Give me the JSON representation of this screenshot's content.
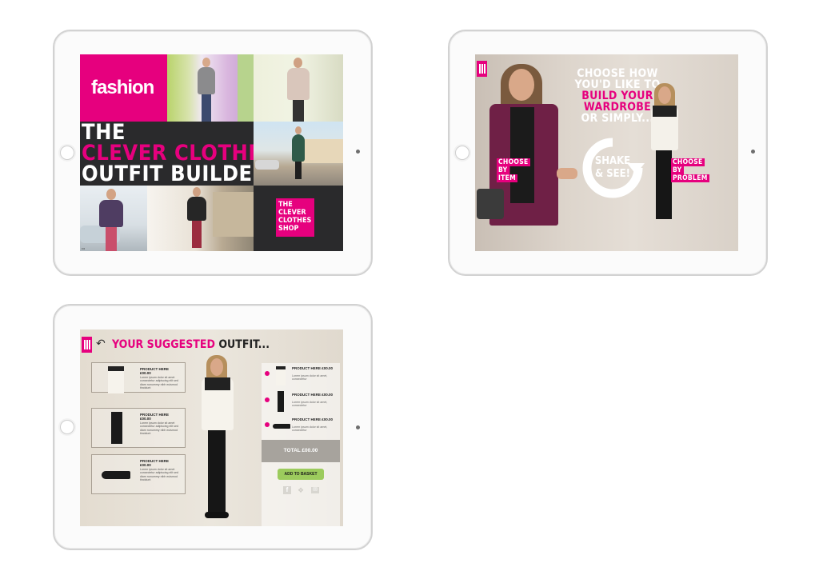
{
  "screen1": {
    "logo": "fashion",
    "title_line1": "THE",
    "title_line2": "CLEVER CLOTHES",
    "title_line3": "OUTFIT BUILDER",
    "shop_badge": "THE CLEVER CLOTHES SHOP"
  },
  "screen2": {
    "headline_line1": "CHOOSE HOW",
    "headline_line2": "YOU'D LIKE TO",
    "headline_line3": "BUILD YOUR",
    "headline_line4": "WARDROBE",
    "headline_line5": "OR SIMPLY...",
    "shake_line1": "SHAKE",
    "shake_line2": "& SEE!",
    "choose_item": [
      "CHOOSE",
      "BY",
      "ITEM"
    ],
    "choose_problem": [
      "CHOOSE",
      "BY",
      "PROBLEM"
    ]
  },
  "screen3": {
    "title_highlight": "YOUR SUGGESTED",
    "title_rest": "OUTFIT...",
    "products": [
      {
        "name": "PRODUCT HERE",
        "price": "£00.00",
        "desc": "Lorem ipsum dolor sit amet consectetur adipiscing elit sed diam nonummy nibh euismod tincidunt"
      },
      {
        "name": "PRODUCT HERE",
        "price": "£00.00",
        "desc": "Lorem ipsum dolor sit amet consectetur adipiscing elit sed diam nonummy nibh euismod tincidunt"
      },
      {
        "name": "PRODUCT HERE",
        "price": "£00.00",
        "desc": "Lorem ipsum dolor sit amet consectetur adipiscing elit sed diam nonummy nibh euismod tincidunt"
      }
    ],
    "summary": [
      {
        "name": "PRODUCT HERE £00.00",
        "desc": "Lorem ipsum dolor sit amet, consectetur"
      },
      {
        "name": "PRODUCT HERE £00.00",
        "desc": "Lorem ipsum dolor sit amet, consectetur"
      },
      {
        "name": "PRODUCT HERE £00.00",
        "desc": "Lorem ipsum dolor sit amet, consectetur"
      }
    ],
    "total": "TOTAL £00.00",
    "add_to_basket": "ADD TO BASKET",
    "share_icons": [
      "facebook-icon",
      "twitter-icon",
      "email-icon"
    ]
  },
  "colors": {
    "brand_pink": "#e6007e",
    "dark_panel": "#2a2a2c",
    "basket_green": "#9ccb5d",
    "total_grey": "#a7a39d"
  }
}
